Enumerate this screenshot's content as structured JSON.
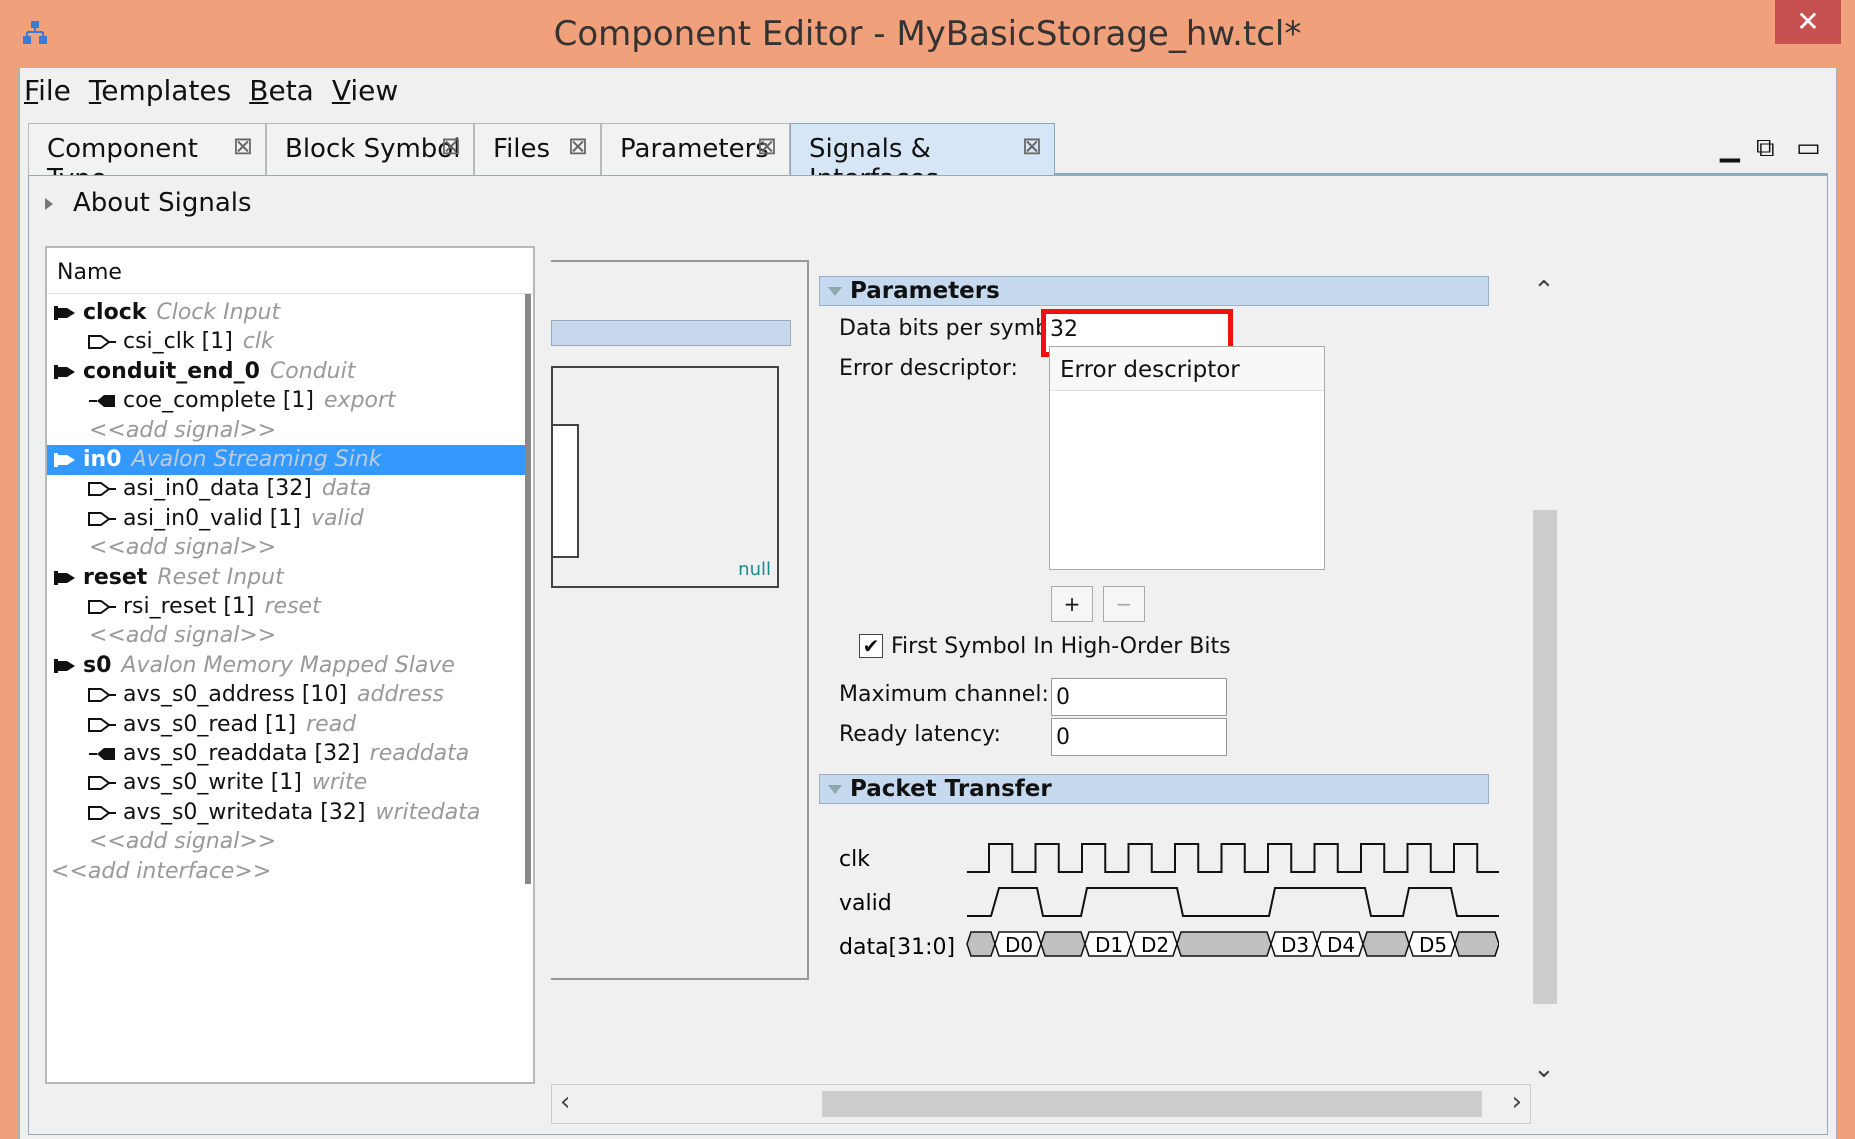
{
  "window": {
    "title": "Component Editor - MyBasicStorage_hw.tcl*",
    "close_glyph": "✕"
  },
  "menu": [
    {
      "key": "F",
      "rest": "ile"
    },
    {
      "key": "T",
      "rest": "emplates"
    },
    {
      "key": "B",
      "rest": "eta"
    },
    {
      "key": "V",
      "rest": "iew"
    }
  ],
  "tabs": [
    {
      "label": "Component Type"
    },
    {
      "label": "Block Symbol"
    },
    {
      "label": "Files"
    },
    {
      "label": "Parameters"
    },
    {
      "label": "Signals & Interfaces",
      "active": true
    }
  ],
  "tab_close_glyph": "⊠",
  "about": {
    "label": "About Signals"
  },
  "tree": {
    "header": "Name",
    "add_signal": "<<add signal>>",
    "add_interface": "<<add interface>>",
    "interfaces": [
      {
        "name": "clock",
        "type": "Clock Input",
        "signals": [
          {
            "name": "csi_clk [1]",
            "role": "clk",
            "direction": "in"
          }
        ],
        "add_signal": false
      },
      {
        "name": "conduit_end_0",
        "type": "Conduit",
        "signals": [
          {
            "name": "coe_complete [1]",
            "role": "export",
            "direction": "out"
          }
        ],
        "add_signal": true
      },
      {
        "name": "in0",
        "type": "Avalon Streaming Sink",
        "selected": true,
        "signals": [
          {
            "name": "asi_in0_data [32]",
            "role": "data",
            "direction": "in"
          },
          {
            "name": "asi_in0_valid [1]",
            "role": "valid",
            "direction": "in"
          }
        ],
        "add_signal": true
      },
      {
        "name": "reset",
        "type": "Reset Input",
        "signals": [
          {
            "name": "rsi_reset [1]",
            "role": "reset",
            "direction": "in"
          }
        ],
        "add_signal": true
      },
      {
        "name": "s0",
        "type": "Avalon Memory Mapped Slave",
        "signals": [
          {
            "name": "avs_s0_address [10]",
            "role": "address",
            "direction": "in"
          },
          {
            "name": "avs_s0_read [1]",
            "role": "read",
            "direction": "in"
          },
          {
            "name": "avs_s0_readdata [32]",
            "role": "readdata",
            "direction": "out"
          },
          {
            "name": "avs_s0_write [1]",
            "role": "write",
            "direction": "in"
          },
          {
            "name": "avs_s0_writedata [32]",
            "role": "writedata",
            "direction": "in"
          }
        ],
        "add_signal": true
      }
    ]
  },
  "middle": {
    "null_label": "null"
  },
  "parameters": {
    "section_title": "Parameters",
    "data_bits_label": "Data bits per symbol:",
    "data_bits_value": "32",
    "error_descriptor_label": "Error descriptor:",
    "error_descriptor_header": "Error descriptor",
    "add_button": "+",
    "remove_button": "−",
    "first_symbol_label": "First Symbol In High-Order Bits",
    "first_symbol_checked": true,
    "max_channel_label": "Maximum channel:",
    "max_channel_value": "0",
    "ready_latency_label": "Ready latency:",
    "ready_latency_value": "0"
  },
  "packet_transfer": {
    "section_title": "Packet Transfer",
    "signals": [
      "clk",
      "valid",
      "data[31:0]"
    ],
    "data_labels": [
      "D0",
      "D1",
      "D2",
      "D3",
      "D4",
      "D5"
    ]
  },
  "colors": {
    "accent_selection": "#3399ff",
    "highlight_box": "#ee1111",
    "title_bar": "#f0a07a"
  }
}
